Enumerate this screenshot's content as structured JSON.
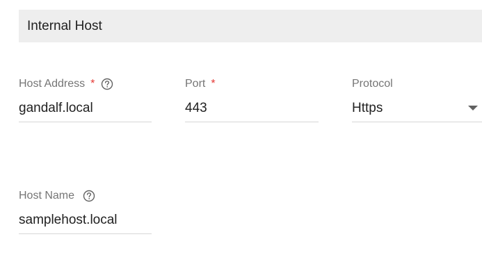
{
  "section": {
    "title": "Internal Host"
  },
  "fields": {
    "host_address": {
      "label": "Host Address",
      "required_mark": "*",
      "value": "gandalf.local"
    },
    "port": {
      "label": "Port",
      "required_mark": "*",
      "value": "443"
    },
    "protocol": {
      "label": "Protocol",
      "value": "Https"
    },
    "host_name": {
      "label": "Host Name",
      "value": "samplehost.local"
    }
  },
  "icons": {
    "help": "help-circle-icon",
    "dropdown": "caret-down-icon"
  },
  "colors": {
    "required": "#e53935",
    "header_bg": "#eeeeee",
    "label": "#757575",
    "underline": "#d6d6d6"
  }
}
